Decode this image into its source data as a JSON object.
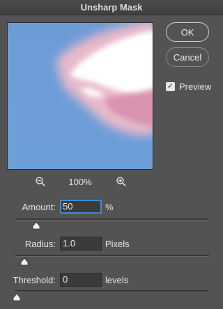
{
  "window": {
    "title": "Unsharp Mask"
  },
  "buttons": {
    "ok": "OK",
    "cancel": "Cancel"
  },
  "preview": {
    "label": "Preview",
    "checked": true
  },
  "zoom": {
    "level": "100%",
    "zoom_out_icon": "zoom-out-icon",
    "zoom_in_icon": "zoom-in-icon"
  },
  "amount": {
    "label": "Amount:",
    "value": "50",
    "unit": "%",
    "slider_fraction": 0.1
  },
  "radius": {
    "label": "Radius:",
    "value": "1.0",
    "unit": "Pixels",
    "slider_fraction": 0.04
  },
  "threshold": {
    "label": "Threshold:",
    "value": "0",
    "unit": "levels",
    "slider_fraction": 0.0
  },
  "colors": {
    "background": "#535353",
    "preview_sky": "#6b9ad6",
    "focus_ring": "#3d8bd8"
  }
}
